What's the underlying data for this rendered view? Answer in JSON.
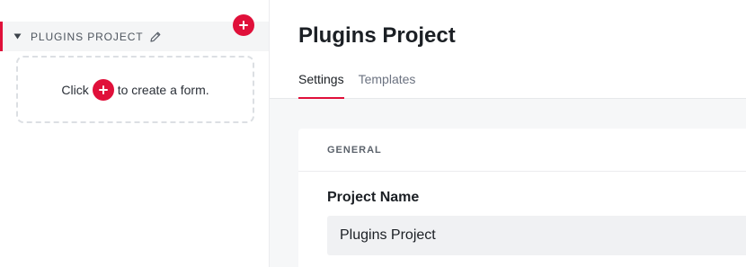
{
  "sidebar": {
    "project": {
      "label": "PLUGINS PROJECT"
    },
    "empty_state": {
      "prefix": "Click",
      "suffix": "to create a form."
    }
  },
  "main": {
    "title": "Plugins Project",
    "tabs": [
      {
        "label": "Settings",
        "active": true
      },
      {
        "label": "Templates",
        "active": false
      }
    ],
    "section": {
      "heading": "GENERAL"
    },
    "field": {
      "label": "Project Name",
      "value": "Plugins Project"
    }
  },
  "colors": {
    "accent": "#e0103a",
    "sidebar_bg": "#ffffff",
    "main_bg": "#f6f7f8",
    "input_bg": "#f0f1f3"
  },
  "icons": {
    "caret": "caret-down-icon",
    "edit": "pencil-icon",
    "add": "plus-circle-icon"
  }
}
